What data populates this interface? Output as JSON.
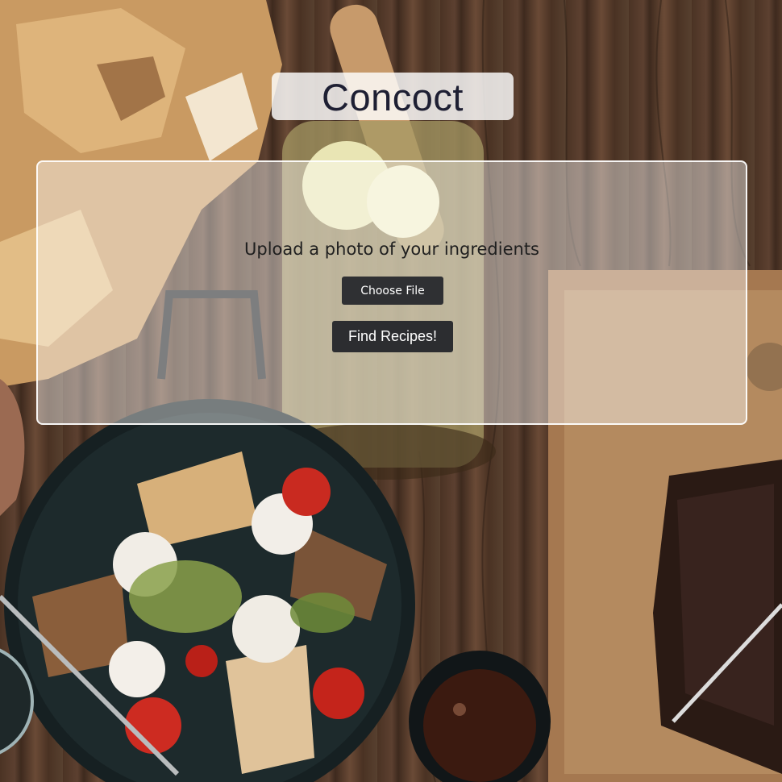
{
  "app": {
    "title": "Concoct"
  },
  "upload": {
    "label": "Upload a photo of your ingredients",
    "choose_file_label": "Choose File",
    "submit_label": "Find Recipes!"
  },
  "background": {
    "icon": "food-photo-background",
    "colors": {
      "wood": "#5c4030",
      "dark_wood": "#3e2a1e",
      "bowl": "#1d2527",
      "bread": "#d9a86a",
      "tomato": "#c8261d",
      "cream": "#f2eee6",
      "lettuce": "#8aa04a",
      "board": "#a57850"
    }
  },
  "theme": {
    "button_bg": "#2f3033",
    "title_color": "#1e1f33"
  }
}
